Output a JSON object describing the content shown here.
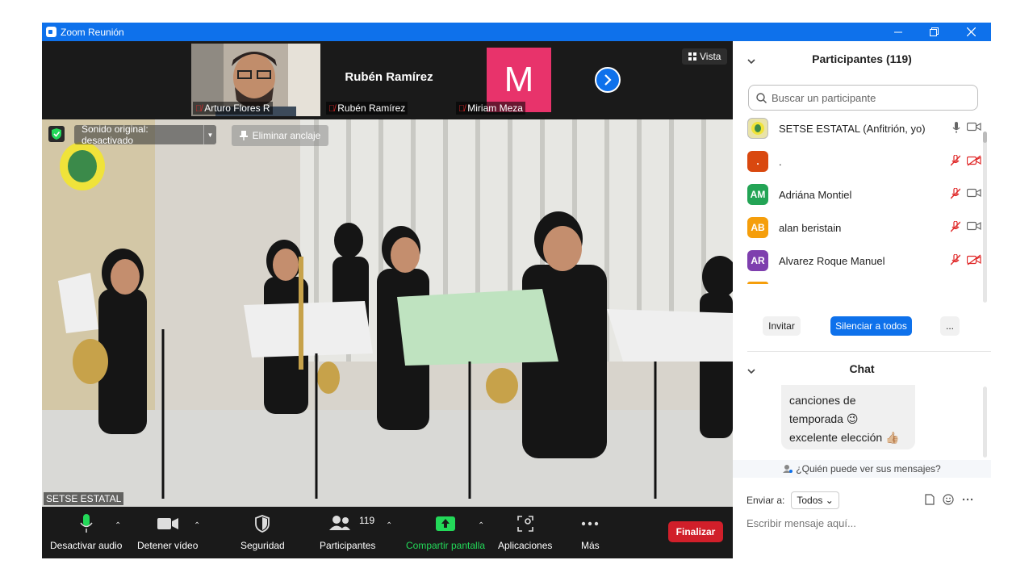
{
  "window": {
    "title": "Zoom Reunión"
  },
  "strip": {
    "tiles": [
      {
        "name": "Arturo Flores R"
      },
      {
        "name": "Rubén Ramírez",
        "display": "Rubén Ramírez"
      },
      {
        "name": "Miriam Meza",
        "initial": "M"
      }
    ],
    "view_label": "Vista"
  },
  "video": {
    "speaker_name": "SETSE ESTATAL",
    "original_sound": "Sonido original: desactivado",
    "unpin": "Eliminar anclaje"
  },
  "toolbar": {
    "mute": "Desactivar audio",
    "video": "Detener vídeo",
    "security": "Seguridad",
    "participants": "Participantes",
    "participants_count": "119",
    "share": "Compartir pantalla",
    "apps": "Aplicaciones",
    "more": "Más",
    "end": "Finalizar"
  },
  "participants_panel": {
    "header": "Participantes (119)",
    "search_placeholder": "Buscar un participante",
    "list": [
      {
        "initials": "",
        "name": "SETSE ESTATAL (Anfitrión, yo)",
        "color": "#e9e3a8"
      },
      {
        "initials": ".",
        "name": ".",
        "color": "#d9480f"
      },
      {
        "initials": "AM",
        "name": "Adriána Montiel",
        "color": "#23a455"
      },
      {
        "initials": "AB",
        "name": "alan beristain",
        "color": "#f59e0b"
      },
      {
        "initials": "AR",
        "name": "Alvarez Roque Manuel",
        "color": "#7e3fae"
      }
    ],
    "invite": "Invitar",
    "mute_all": "Silenciar a todos",
    "more": "..."
  },
  "chat": {
    "header": "Chat",
    "message_lines": [
      "canciones de",
      "temporada 😉",
      "excelente elección 👍🏼"
    ],
    "who_can_see": "¿Quién puede ver sus mensajes?",
    "send_to_label": "Enviar a:",
    "send_to_value": "Todos",
    "input_placeholder": "Escribir mensaje aquí..."
  },
  "colors": {
    "zoom_blue": "#0e71eb",
    "end_red": "#d11f2a",
    "share_green": "#23d959",
    "muted_red": "#e02828"
  }
}
